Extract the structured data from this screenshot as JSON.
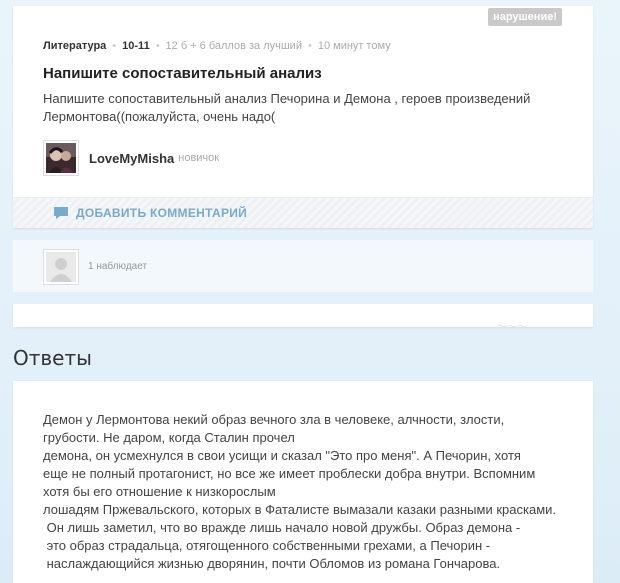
{
  "question": {
    "report_label": "нарушение!",
    "subject": "Литература",
    "grade": "10-11",
    "points": "12 б + 6 баллов за лучший",
    "time": "10 минут тому",
    "title": "Напишите сопоставительный анализ",
    "body": "Напишите сопоставительный анализ Печорина и Демона , героев произведений Лермонтова((пожалуйста, очень надо(",
    "author_name": "LoveMyMisha",
    "author_rank": "новичок",
    "add_comment_label": "ДОБАВИТЬ КОММЕНТАРИЙ"
  },
  "watchers": {
    "text": "1 наблюдает"
  },
  "answers": {
    "heading": "Ответы",
    "lines": [
      "Демон у Лермонтова некий образ вечного зла в человеке, алчности, злости,",
      "грубости. Не даром, когда Сталин прочел",
      "демона, он усмехнулся в свои усищи и сказал \"Это про меня\". А Печорин, хотя",
      "еще не полный протагонист, но все же имеет проблески добра внутри. Вспомним",
      "хотя бы его отношение к низкорослым",
      "лошадям Пржевальского, которых в Фаталисте вымазали казаки разными красками.",
      " Он лишь заметил, что во вражде лишь начало новой дружбы. Образ демона -",
      " это образ страдальца, отягощенного собственными грехами, а Печорин -",
      " наслаждающийся жизнью дворянин, почти Обломов из романа Гончарова."
    ]
  },
  "icons": {
    "comment": "speech-bubble-icon",
    "watcher_avatar": "default-user-icon"
  },
  "colors": {
    "accent": "#7ba9c9",
    "report_bg": "#c9c9c9"
  }
}
